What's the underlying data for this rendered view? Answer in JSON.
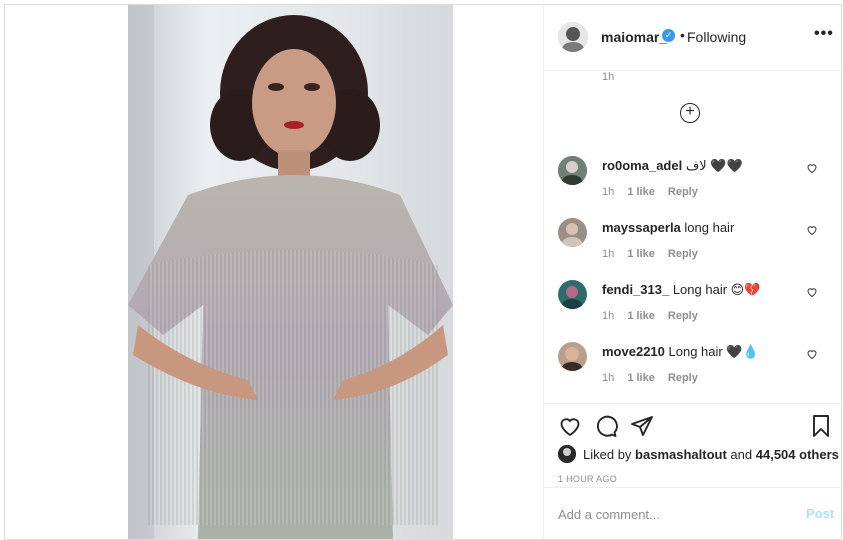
{
  "post": {
    "username": "maiomar_",
    "following_label": "Following",
    "separator": "•",
    "more_label": "•••"
  },
  "comments": {
    "top_time": "1h",
    "load_more_label": "+",
    "items": [
      {
        "user": "ro0oma_adel",
        "text": "لاف 🖤🖤",
        "time": "1h",
        "likes": "1 like",
        "reply": "Reply"
      },
      {
        "user": "mayssaperla",
        "text": "long hair",
        "time": "1h",
        "likes": "1 like",
        "reply": "Reply"
      },
      {
        "user": "fendi_313_",
        "text": "Long hair 😊💔",
        "time": "1h",
        "likes": "1 like",
        "reply": "Reply"
      },
      {
        "user": "move2210",
        "text": "Long hair 🖤💧",
        "time": "1h",
        "likes": "1 like",
        "reply": "Reply"
      }
    ]
  },
  "liked": {
    "prefix": "Liked by",
    "user": "basmashaltout",
    "and": "and",
    "others": "44,504 others"
  },
  "posted_time": "1 HOUR AGO",
  "add_comment": {
    "placeholder": "Add a comment...",
    "post_label": "Post"
  },
  "icons": {
    "verified": "verified-badge-icon",
    "like": "heart-icon",
    "comment": "comment-bubble-icon",
    "share": "paper-plane-icon",
    "save": "bookmark-icon",
    "load_more": "plus-circle-icon"
  },
  "colors": {
    "verified_blue": "#3897f0",
    "post_button_disabled": "#b2dffc",
    "muted_text": "#8e8e8e",
    "text": "#262626",
    "border": "#efefef"
  }
}
